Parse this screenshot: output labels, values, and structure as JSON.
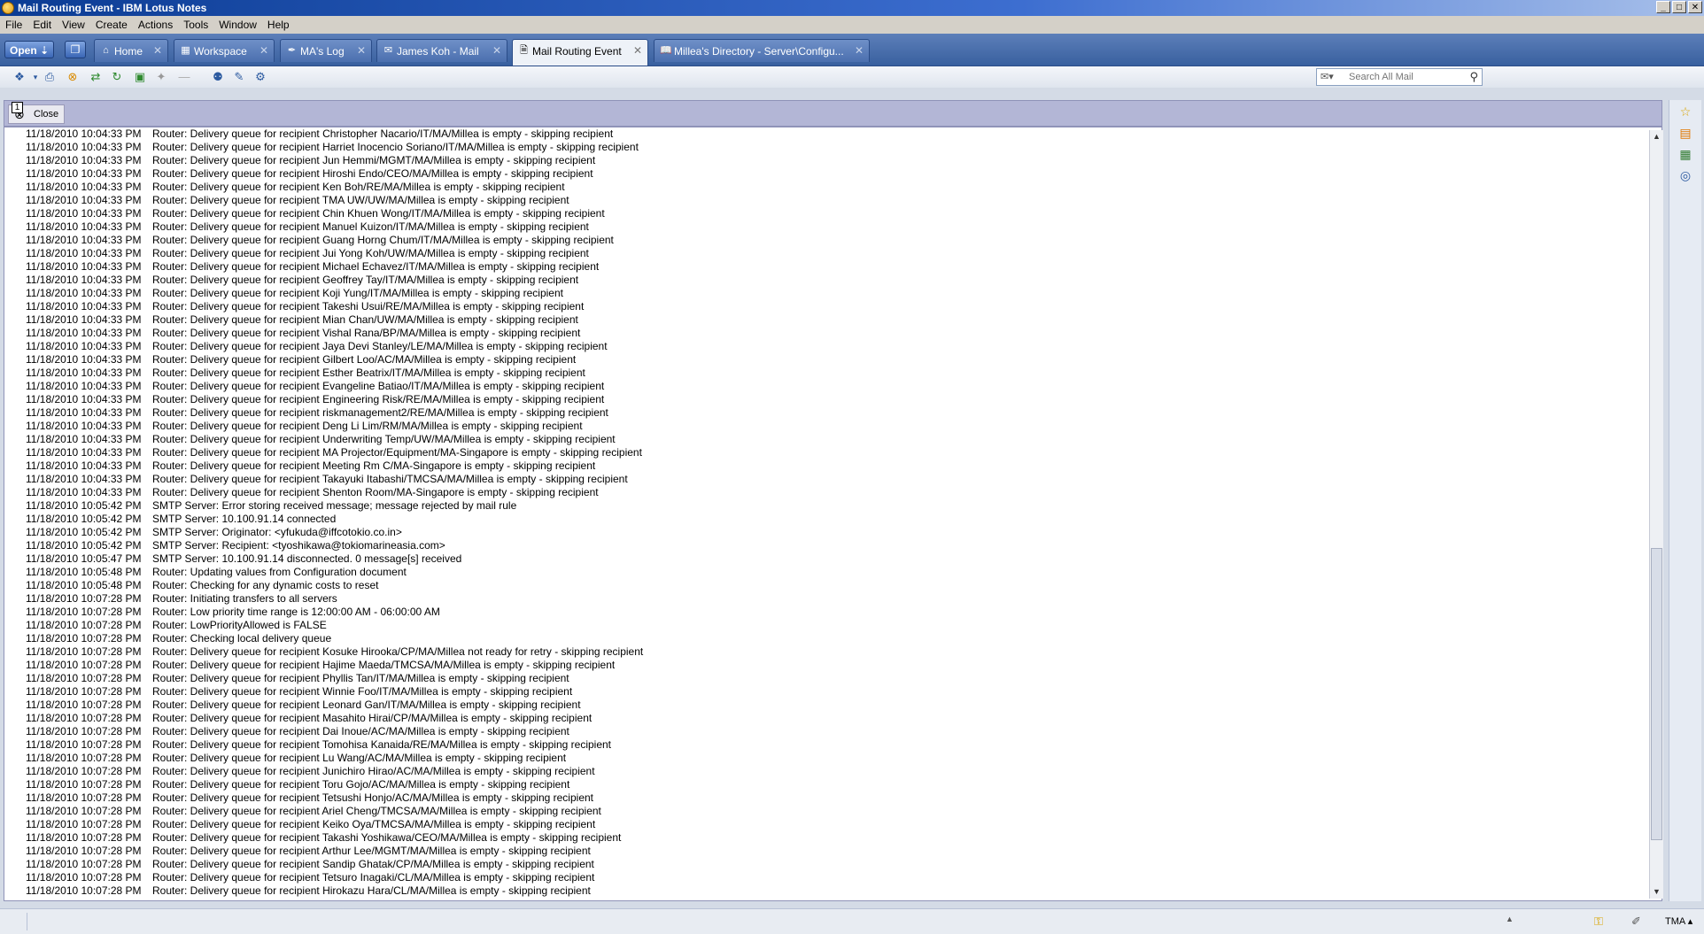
{
  "window": {
    "title": "Mail Routing Event - IBM Lotus Notes",
    "min_label": "_",
    "max_label": "□",
    "close_label": "✕"
  },
  "menu": [
    "File",
    "Edit",
    "View",
    "Create",
    "Actions",
    "Tools",
    "Window",
    "Help"
  ],
  "open_button": {
    "label": "Open"
  },
  "tabs": [
    {
      "label": "Home",
      "icon": "home-icon"
    },
    {
      "label": "Workspace",
      "icon": "workspace-icon"
    },
    {
      "label": "MA's Log",
      "icon": "log-icon"
    },
    {
      "label": "James Koh - Mail",
      "icon": "mail-icon"
    },
    {
      "label": "Mail Routing Event",
      "icon": "document-icon",
      "active": true
    },
    {
      "label": "Millea's Directory - Server\\Configu...",
      "icon": "directory-icon"
    }
  ],
  "search": {
    "placeholder": "Search All Mail"
  },
  "action_bar": {
    "close_label": "Close",
    "badge": "1"
  },
  "log": [
    [
      "11/18/2010 10:04:33 PM",
      "Router: Delivery queue for recipient Christopher Nacario/IT/MA/Millea is empty - skipping recipient"
    ],
    [
      "11/18/2010 10:04:33 PM",
      "Router: Delivery queue for recipient Harriet Inocencio Soriano/IT/MA/Millea is empty - skipping recipient"
    ],
    [
      "11/18/2010 10:04:33 PM",
      "Router: Delivery queue for recipient Jun Hemmi/MGMT/MA/Millea is empty - skipping recipient"
    ],
    [
      "11/18/2010 10:04:33 PM",
      "Router: Delivery queue for recipient Hiroshi Endo/CEO/MA/Millea is empty - skipping recipient"
    ],
    [
      "11/18/2010 10:04:33 PM",
      "Router: Delivery queue for recipient Ken Boh/RE/MA/Millea is empty - skipping recipient"
    ],
    [
      "11/18/2010 10:04:33 PM",
      "Router: Delivery queue for recipient TMA UW/UW/MA/Millea is empty - skipping recipient"
    ],
    [
      "11/18/2010 10:04:33 PM",
      "Router: Delivery queue for recipient Chin Khuen Wong/IT/MA/Millea is empty - skipping recipient"
    ],
    [
      "11/18/2010 10:04:33 PM",
      "Router: Delivery queue for recipient Manuel Kuizon/IT/MA/Millea is empty - skipping recipient"
    ],
    [
      "11/18/2010 10:04:33 PM",
      "Router: Delivery queue for recipient Guang Horng Chum/IT/MA/Millea is empty - skipping recipient"
    ],
    [
      "11/18/2010 10:04:33 PM",
      "Router: Delivery queue for recipient Jui Yong Koh/UW/MA/Millea is empty - skipping recipient"
    ],
    [
      "11/18/2010 10:04:33 PM",
      "Router: Delivery queue for recipient Michael Echavez/IT/MA/Millea is empty - skipping recipient"
    ],
    [
      "11/18/2010 10:04:33 PM",
      "Router: Delivery queue for recipient Geoffrey Tay/IT/MA/Millea is empty - skipping recipient"
    ],
    [
      "11/18/2010 10:04:33 PM",
      "Router: Delivery queue for recipient Koji Yung/IT/MA/Millea is empty - skipping recipient"
    ],
    [
      "11/18/2010 10:04:33 PM",
      "Router: Delivery queue for recipient Takeshi Usui/RE/MA/Millea is empty - skipping recipient"
    ],
    [
      "11/18/2010 10:04:33 PM",
      "Router: Delivery queue for recipient Mian Chan/UW/MA/Millea is empty - skipping recipient"
    ],
    [
      "11/18/2010 10:04:33 PM",
      "Router: Delivery queue for recipient Vishal Rana/BP/MA/Millea is empty - skipping recipient"
    ],
    [
      "11/18/2010 10:04:33 PM",
      "Router: Delivery queue for recipient Jaya Devi Stanley/LE/MA/Millea is empty - skipping recipient"
    ],
    [
      "11/18/2010 10:04:33 PM",
      "Router: Delivery queue for recipient Gilbert Loo/AC/MA/Millea is empty - skipping recipient"
    ],
    [
      "11/18/2010 10:04:33 PM",
      "Router: Delivery queue for recipient Esther Beatrix/IT/MA/Millea is empty - skipping recipient"
    ],
    [
      "11/18/2010 10:04:33 PM",
      "Router: Delivery queue for recipient Evangeline Batiao/IT/MA/Millea is empty - skipping recipient"
    ],
    [
      "11/18/2010 10:04:33 PM",
      "Router: Delivery queue for recipient Engineering Risk/RE/MA/Millea is empty - skipping recipient"
    ],
    [
      "11/18/2010 10:04:33 PM",
      "Router: Delivery queue for recipient riskmanagement2/RE/MA/Millea is empty - skipping recipient"
    ],
    [
      "11/18/2010 10:04:33 PM",
      "Router: Delivery queue for recipient Deng Li Lim/RM/MA/Millea is empty - skipping recipient"
    ],
    [
      "11/18/2010 10:04:33 PM",
      "Router: Delivery queue for recipient Underwriting Temp/UW/MA/Millea is empty - skipping recipient"
    ],
    [
      "11/18/2010 10:04:33 PM",
      "Router: Delivery queue for recipient MA Projector/Equipment/MA-Singapore is empty - skipping recipient"
    ],
    [
      "11/18/2010 10:04:33 PM",
      "Router: Delivery queue for recipient Meeting Rm C/MA-Singapore is empty - skipping recipient"
    ],
    [
      "11/18/2010 10:04:33 PM",
      "Router: Delivery queue for recipient Takayuki Itabashi/TMCSA/MA/Millea is empty - skipping recipient"
    ],
    [
      "11/18/2010 10:04:33 PM",
      "Router: Delivery queue for recipient Shenton Room/MA-Singapore is empty - skipping recipient"
    ],
    [
      "11/18/2010 10:05:42 PM",
      "SMTP Server: Error storing received message; message rejected by mail rule"
    ],
    [
      "11/18/2010 10:05:42 PM",
      "SMTP Server: 10.100.91.14 connected"
    ],
    [
      "11/18/2010 10:05:42 PM",
      "SMTP Server: Originator: <yfukuda@iffcotokio.co.in>"
    ],
    [
      "11/18/2010 10:05:42 PM",
      "SMTP Server: Recipient: <tyoshikawa@tokiomarineasia.com>"
    ],
    [
      "11/18/2010 10:05:47 PM",
      "SMTP Server: 10.100.91.14 disconnected. 0 message[s] received"
    ],
    [
      "11/18/2010 10:05:48 PM",
      "Router: Updating values from Configuration document"
    ],
    [
      "11/18/2010 10:05:48 PM",
      "Router: Checking for any dynamic costs to reset"
    ],
    [
      "11/18/2010 10:07:28 PM",
      "Router: Initiating transfers to all servers"
    ],
    [
      "11/18/2010 10:07:28 PM",
      "Router: Low priority time range is 12:00:00 AM - 06:00:00 AM"
    ],
    [
      "11/18/2010 10:07:28 PM",
      "Router: LowPriorityAllowed is FALSE"
    ],
    [
      "11/18/2010 10:07:28 PM",
      "Router: Checking local delivery queue"
    ],
    [
      "11/18/2010 10:07:28 PM",
      "Router: Delivery queue for recipient Kosuke Hirooka/CP/MA/Millea not ready for retry - skipping recipient"
    ],
    [
      "11/18/2010 10:07:28 PM",
      "Router: Delivery queue for recipient Hajime Maeda/TMCSA/MA/Millea is empty - skipping recipient"
    ],
    [
      "11/18/2010 10:07:28 PM",
      "Router: Delivery queue for recipient Phyllis Tan/IT/MA/Millea is empty - skipping recipient"
    ],
    [
      "11/18/2010 10:07:28 PM",
      "Router: Delivery queue for recipient Winnie Foo/IT/MA/Millea is empty - skipping recipient"
    ],
    [
      "11/18/2010 10:07:28 PM",
      "Router: Delivery queue for recipient Leonard Gan/IT/MA/Millea is empty - skipping recipient"
    ],
    [
      "11/18/2010 10:07:28 PM",
      "Router: Delivery queue for recipient Masahito Hirai/CP/MA/Millea is empty - skipping recipient"
    ],
    [
      "11/18/2010 10:07:28 PM",
      "Router: Delivery queue for recipient Dai Inoue/AC/MA/Millea is empty - skipping recipient"
    ],
    [
      "11/18/2010 10:07:28 PM",
      "Router: Delivery queue for recipient Tomohisa Kanaida/RE/MA/Millea is empty - skipping recipient"
    ],
    [
      "11/18/2010 10:07:28 PM",
      "Router: Delivery queue for recipient Lu Wang/AC/MA/Millea is empty - skipping recipient"
    ],
    [
      "11/18/2010 10:07:28 PM",
      "Router: Delivery queue for recipient Junichiro Hirao/AC/MA/Millea is empty - skipping recipient"
    ],
    [
      "11/18/2010 10:07:28 PM",
      "Router: Delivery queue for recipient Toru Gojo/AC/MA/Millea is empty - skipping recipient"
    ],
    [
      "11/18/2010 10:07:28 PM",
      "Router: Delivery queue for recipient Tetsushi Honjo/AC/MA/Millea is empty - skipping recipient"
    ],
    [
      "11/18/2010 10:07:28 PM",
      "Router: Delivery queue for recipient Ariel Cheng/TMCSA/MA/Millea is empty - skipping recipient"
    ],
    [
      "11/18/2010 10:07:28 PM",
      "Router: Delivery queue for recipient Keiko Oya/TMCSA/MA/Millea is empty - skipping recipient"
    ],
    [
      "11/18/2010 10:07:28 PM",
      "Router: Delivery queue for recipient Takashi Yoshikawa/CEO/MA/Millea is empty - skipping recipient"
    ],
    [
      "11/18/2010 10:07:28 PM",
      "Router: Delivery queue for recipient Arthur Lee/MGMT/MA/Millea is empty - skipping recipient"
    ],
    [
      "11/18/2010 10:07:28 PM",
      "Router: Delivery queue for recipient Sandip Ghatak/CP/MA/Millea is empty - skipping recipient"
    ],
    [
      "11/18/2010 10:07:28 PM",
      "Router: Delivery queue for recipient Tetsuro Inagaki/CL/MA/Millea is empty - skipping recipient"
    ],
    [
      "11/18/2010 10:07:28 PM",
      "Router: Delivery queue for recipient Hirokazu Hara/CL/MA/Millea is empty - skipping recipient"
    ]
  ],
  "status": {
    "location": "TMA"
  }
}
